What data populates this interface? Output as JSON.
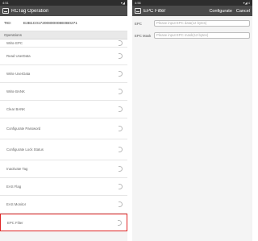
{
  "left_screen": {
    "status": {
      "time": "4:51",
      "icons": "▾◢"
    },
    "title": "RCTag Operation",
    "tid": {
      "label": "TID:",
      "value": "E2B1C017200800008E0B0271"
    },
    "section_header": "Operations",
    "operations": [
      {
        "label": "Write EPC"
      },
      {
        "label": "Read UserData"
      },
      {
        "label": "Write UserData"
      },
      {
        "label": "Write BANK"
      },
      {
        "label": "Clear BANK"
      },
      {
        "label": "Configurate Password"
      },
      {
        "label": "Configurate Lock Status"
      },
      {
        "label": "Inactivate Tag"
      },
      {
        "label": "EAS Flag"
      },
      {
        "label": "EAS Monitor"
      },
      {
        "label": "EPC Filter",
        "highlighted": true
      }
    ]
  },
  "right_screen": {
    "status": {
      "time": "4:56",
      "icons": "▾◢ 4"
    },
    "title": "EPC Filter",
    "actions": {
      "configurate": "Configurate",
      "cancel": "Cancel"
    },
    "fields": [
      {
        "label": "EPC",
        "placeholder": "Please input EPC data(12 bytes)"
      },
      {
        "label": "EPC Mask",
        "placeholder": "Please input EPC mask(12 bytes)"
      }
    ]
  },
  "colors": {
    "appbar": "#4a4a4a",
    "statusbar": "#2d2d2d",
    "highlight": "#e02525"
  }
}
